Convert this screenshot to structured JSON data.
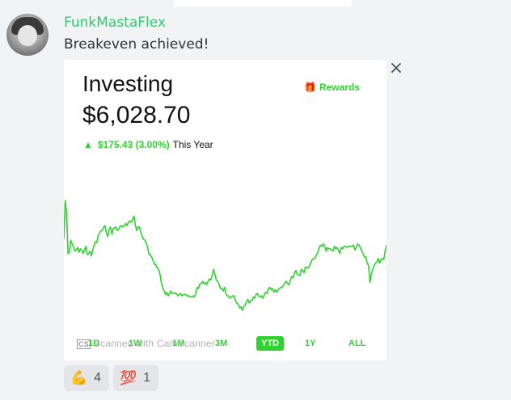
{
  "message": {
    "author": "FunkMastaFlex",
    "text": "Breakeven achieved!"
  },
  "screenshot": {
    "title": "Investing",
    "balance": "$6,028.70",
    "rewards_label": "Rewards",
    "change_amount": "$175.43 (3.00%)",
    "change_period": "This Year",
    "ranges": [
      "1D",
      "1W",
      "1M",
      "3M",
      "YTD",
      "1Y",
      "ALL"
    ],
    "active_range": "YTD",
    "watermark": "Scanned with CamScanner",
    "accent_color": "#2fd22f"
  },
  "chart_data": {
    "type": "line",
    "series": [
      {
        "values": [
          50,
          82,
          71,
          38,
          39,
          49,
          46,
          44,
          40,
          41,
          43,
          39,
          42,
          41,
          38,
          41,
          44,
          37,
          38,
          40,
          36,
          41,
          45,
          48,
          47,
          53,
          55,
          57,
          57,
          60,
          61,
          55,
          52,
          58,
          60,
          54,
          59,
          59,
          60,
          57,
          58,
          61,
          61,
          60,
          61,
          63,
          61,
          64,
          65,
          64,
          66,
          69,
          62,
          57,
          60,
          60,
          56,
          52,
          50,
          49,
          47,
          43,
          37,
          37,
          35,
          32,
          29,
          29,
          26,
          25,
          21,
          14,
          10,
          7,
          4,
          6,
          3,
          5,
          7,
          5,
          5,
          5,
          5,
          3,
          4,
          5,
          3,
          4,
          4,
          4,
          3,
          3,
          2,
          2,
          3,
          2,
          5,
          10,
          9,
          13,
          13,
          15,
          13,
          14,
          12,
          15,
          17,
          16,
          20,
          25,
          21,
          16,
          15,
          13,
          9,
          9,
          7,
          10,
          5,
          3,
          3,
          1,
          2,
          3,
          3,
          -1,
          -3,
          -4,
          -7,
          -6,
          -9,
          -6,
          -5,
          -2,
          0,
          -3,
          -1,
          -1,
          2,
          1,
          4,
          5,
          3,
          2,
          3,
          1,
          4,
          6,
          5,
          9,
          10,
          8,
          9,
          6,
          8,
          6,
          8,
          9,
          10,
          10,
          12,
          14,
          15,
          13,
          12,
          16,
          19,
          18,
          22,
          24,
          21,
          20,
          20,
          25,
          24,
          22,
          27,
          26,
          26,
          28,
          31,
          33,
          34,
          34,
          37,
          39,
          43,
          45,
          44,
          46,
          44,
          40,
          43,
          42,
          42,
          41,
          40,
          44,
          42,
          43,
          41,
          38,
          43,
          42,
          44,
          44,
          43,
          44,
          44,
          44,
          44,
          45,
          41,
          43,
          46,
          45,
          43,
          40,
          38,
          35,
          35,
          30,
          28,
          14,
          21,
          25,
          28,
          30,
          31,
          34,
          30,
          33,
          34,
          33,
          40,
          45
        ]
      }
    ]
  },
  "reactions": [
    {
      "emoji": "💪",
      "count": "4"
    },
    {
      "emoji": "💯",
      "count": "1"
    }
  ]
}
